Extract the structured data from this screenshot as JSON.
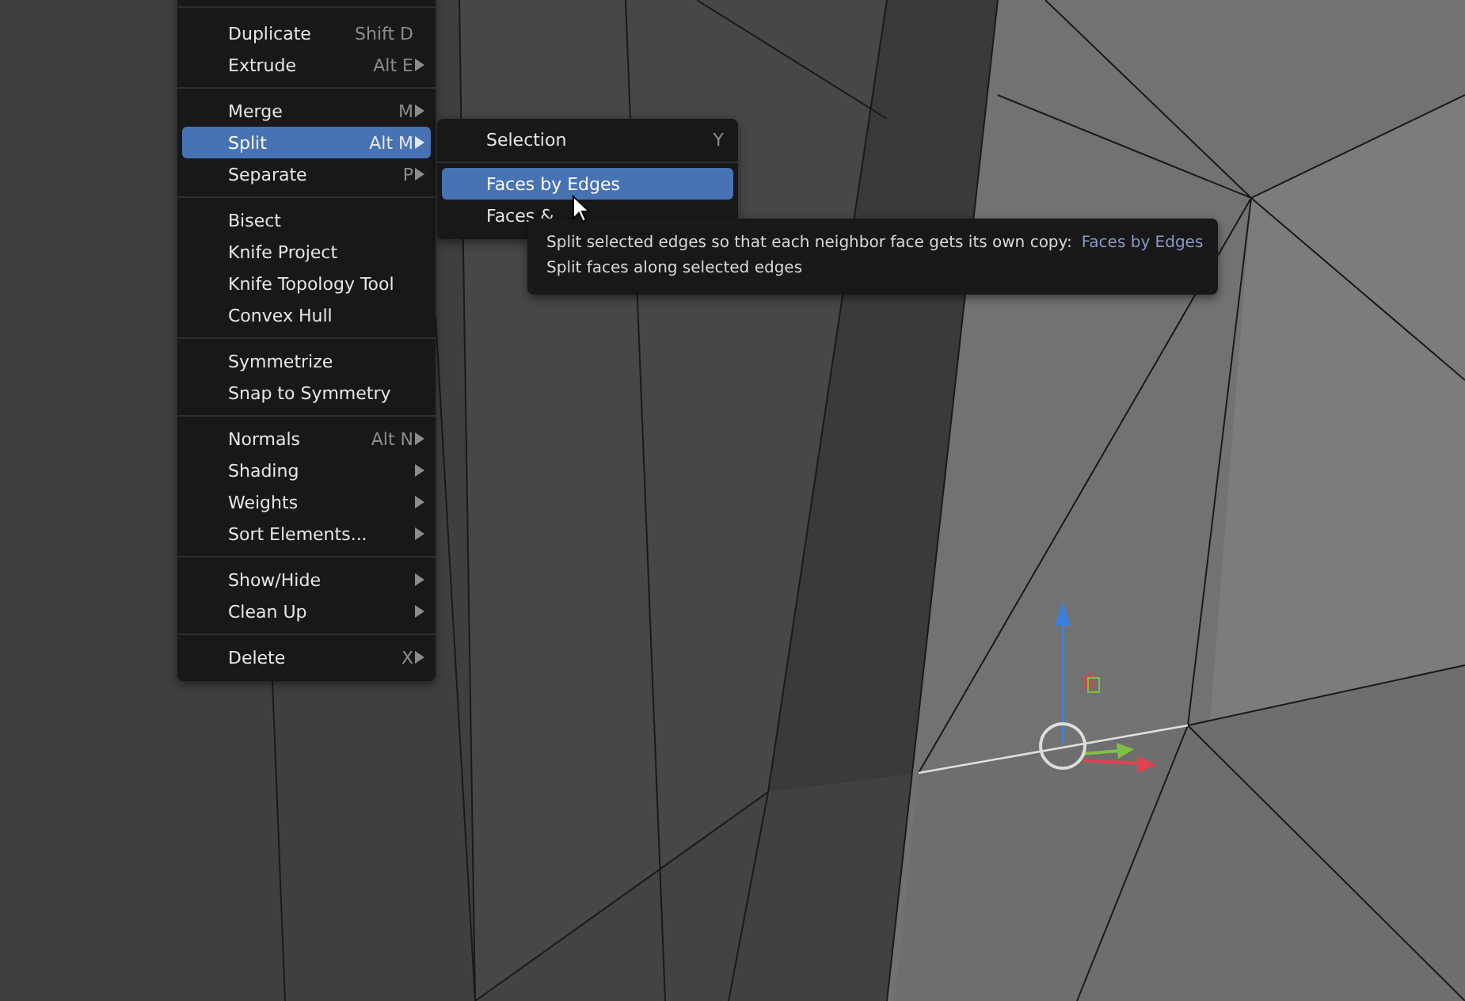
{
  "menu": {
    "groups": [
      [
        {
          "label": "Duplicate",
          "shortcut": "Shift D",
          "submenu": false,
          "selected": false
        },
        {
          "label": "Extrude",
          "shortcut": "Alt E",
          "submenu": true,
          "selected": false
        }
      ],
      [
        {
          "label": "Merge",
          "shortcut": "M",
          "submenu": true,
          "selected": false
        },
        {
          "label": "Split",
          "shortcut": "Alt M",
          "submenu": true,
          "selected": true
        },
        {
          "label": "Separate",
          "shortcut": "P",
          "submenu": true,
          "selected": false
        }
      ],
      [
        {
          "label": "Bisect",
          "submenu": false,
          "selected": false
        },
        {
          "label": "Knife Project",
          "submenu": false,
          "selected": false
        },
        {
          "label": "Knife Topology Tool",
          "submenu": false,
          "selected": false
        },
        {
          "label": "Convex Hull",
          "submenu": false,
          "selected": false
        }
      ],
      [
        {
          "label": "Symmetrize",
          "submenu": false,
          "selected": false
        },
        {
          "label": "Snap to Symmetry",
          "submenu": false,
          "selected": false
        }
      ],
      [
        {
          "label": "Normals",
          "shortcut": "Alt N",
          "submenu": true,
          "selected": false
        },
        {
          "label": "Shading",
          "submenu": true,
          "selected": false
        },
        {
          "label": "Weights",
          "submenu": true,
          "selected": false
        },
        {
          "label": "Sort Elements...",
          "submenu": true,
          "selected": false
        }
      ],
      [
        {
          "label": "Show/Hide",
          "submenu": true,
          "selected": false
        },
        {
          "label": "Clean Up",
          "submenu": true,
          "selected": false
        }
      ],
      [
        {
          "label": "Delete",
          "shortcut": "X",
          "submenu": true,
          "selected": false
        }
      ]
    ]
  },
  "submenu": {
    "groups": [
      [
        {
          "label": "Selection",
          "shortcut": "Y",
          "selected": false
        }
      ],
      [
        {
          "label": "Faces by Edges",
          "selected": true
        },
        {
          "label": "Faces &",
          "selected": false
        }
      ]
    ]
  },
  "tooltip": {
    "description": "Split selected edges so that each neighbor face gets its own copy:",
    "operator": "Faces by Edges",
    "detail": "Split faces along selected edges"
  }
}
